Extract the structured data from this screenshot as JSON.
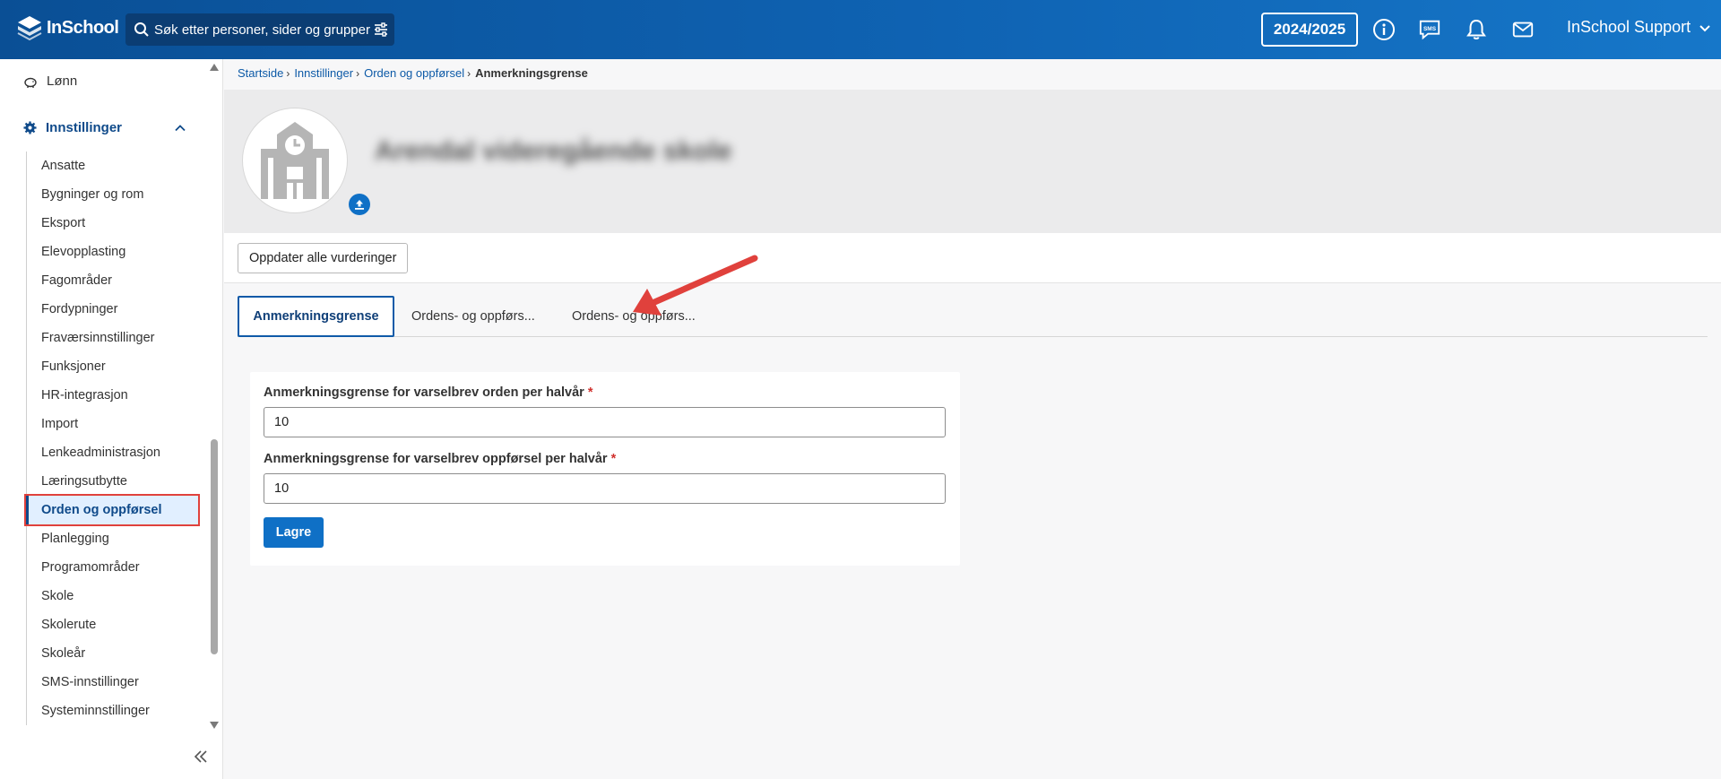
{
  "app": {
    "logo_text": "InSchool"
  },
  "search": {
    "placeholder": "Søk etter personer, sider og grupper"
  },
  "header": {
    "school_year": "2024/2025",
    "user_name": "InSchool Support"
  },
  "sidebar": {
    "top_item": "Lønn",
    "section_title": "Innstillinger",
    "items": [
      "Ansatte",
      "Bygninger og rom",
      "Eksport",
      "Elevopplasting",
      "Fagområder",
      "Fordypninger",
      "Fraværsinnstillinger",
      "Funksjoner",
      "HR-integrasjon",
      "Import",
      "Lenkeadministrasjon",
      "Læringsutbytte",
      "Orden og oppførsel",
      "Planlegging",
      "Programområder",
      "Skole",
      "Skolerute",
      "Skoleår",
      "SMS-innstillinger",
      "Systeminnstillinger"
    ],
    "active_item": "Orden og oppførsel"
  },
  "breadcrumb": {
    "items": [
      "Startside",
      "Innstillinger",
      "Orden og oppførsel"
    ],
    "current": "Anmerkningsgrense"
  },
  "profile": {
    "school_name": "Arendal videregående skole"
  },
  "actions": {
    "update_all_label": "Oppdater alle vurderinger"
  },
  "tabs": [
    "Anmerkningsgrense",
    "Ordens- og oppførs...",
    "Ordens- og oppførs..."
  ],
  "form": {
    "field1_label": "Anmerkningsgrense for varselbrev orden per halvår",
    "field1_value": "10",
    "field2_label": "Anmerkningsgrense for varselbrev oppførsel per halvår",
    "field2_value": "10",
    "required_mark": "*",
    "save_label": "Lagre"
  },
  "colors": {
    "header": "#0f63b3",
    "accent": "#0f70c6",
    "highlight": "#e0413c"
  },
  "icons": [
    "search-icon",
    "filter-icon",
    "info-icon",
    "sms-icon",
    "bell-icon",
    "mail-icon",
    "chevron-down-icon",
    "piggy-bank-icon",
    "gear-icon",
    "chevron-up-icon",
    "school-building-icon",
    "upload-icon",
    "double-chevron-left-icon"
  ]
}
